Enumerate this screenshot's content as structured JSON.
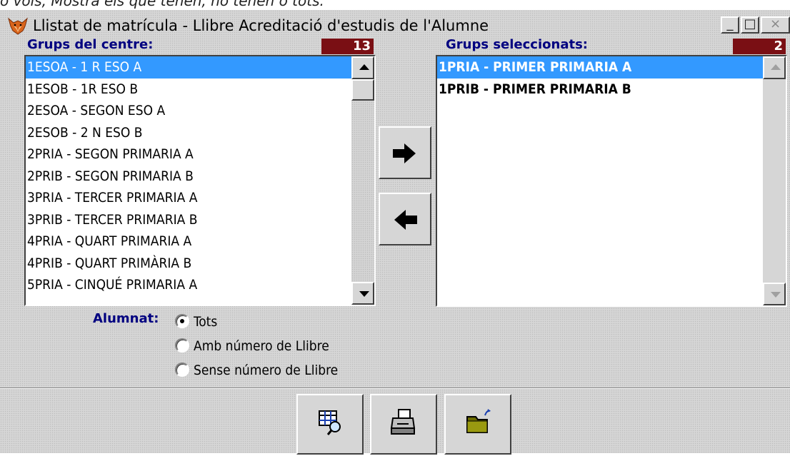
{
  "top_text": "o vols, Mostra els que tenen, no tenen o tots.",
  "window": {
    "title": "Llistat de matrícula - Llibre Acreditació d'estudis de l'Alumne",
    "minimize": "_",
    "maximize": "□",
    "close": "×"
  },
  "left": {
    "label": "Grups del centre:",
    "count": "13",
    "items": [
      "1ESOA - 1 R ESO A",
      "1ESOB -  1R ESO B",
      "2ESOA - SEGON ESO A",
      "2ESOB - 2 N ESO B",
      "2PRIA - SEGON PRIMARIA A",
      "2PRIB -  SEGON PRIMARIA B",
      "3PRIA - TERCER PRIMARIA A",
      "3PRIB - TERCER PRIMARIA B",
      "4PRIA - QUART PRIMARIA A",
      "4PRIB - QUART PRIMÀRIA B",
      "5PRIA - CINQUÉ PRIMARIA A"
    ]
  },
  "right": {
    "label": "Grups seleccionats:",
    "count": "2",
    "items": [
      "1PRIA - PRIMER PRIMARIA A",
      "1PRIB - PRIMER PRIMARIA B"
    ]
  },
  "alumnat": {
    "label": "Alumnat:",
    "options": [
      "Tots",
      "Amb número de Llibre",
      "Sense número de Llibre"
    ],
    "selected": "Tots"
  },
  "icons": {
    "add": "arrow-right-icon",
    "remove": "arrow-left-icon",
    "preview": "print-preview-icon",
    "print": "printer-icon",
    "exit": "exit-folder-icon"
  },
  "colors": {
    "selection": "#3399ff",
    "counter_bg": "#7a0f14",
    "label": "#000080"
  }
}
